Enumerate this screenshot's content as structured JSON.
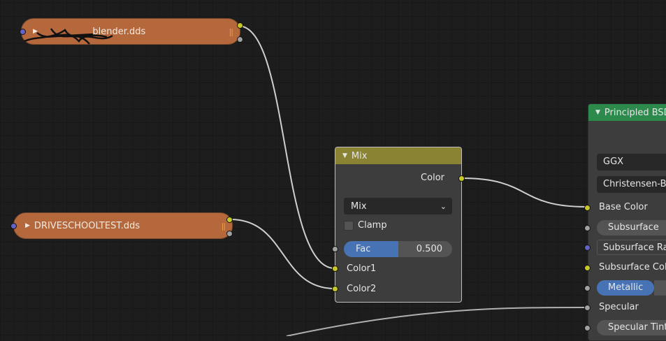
{
  "editor": {
    "name": "shader-editor"
  },
  "nodes": {
    "image1": {
      "label": "_blender.dds"
    },
    "image2": {
      "label": "DRIVESCHOOLTEST.dds"
    },
    "mix": {
      "title": "Mix",
      "output_color": "Color",
      "blend_type": "Mix",
      "clamp_label": "Clamp",
      "fac_label": "Fac",
      "fac_value": "0.500",
      "fac_fraction": 0.5,
      "color1_label": "Color1",
      "color2_label": "Color2"
    },
    "principled": {
      "title": "Principled BSDF",
      "distribution": "GGX",
      "subsurface_method": "Christensen-Burley",
      "inputs": {
        "base_color": "Base Color",
        "subsurface": "Subsurface",
        "subsurface_radius": "Subsurface Radius",
        "subsurface_color": "Subsurface Color",
        "metallic": "Metallic",
        "specular": "Specular",
        "specular_tint": "Specular Tint"
      }
    }
  },
  "colors": {
    "image_node": "#b5683c",
    "mix_header": "#8b8334",
    "bsdf_header": "#2c8a4c",
    "socket_color": "#c7c729",
    "socket_float": "#a1a1a1",
    "socket_vector": "#6363c7",
    "slider_fill": "#4772b3"
  }
}
